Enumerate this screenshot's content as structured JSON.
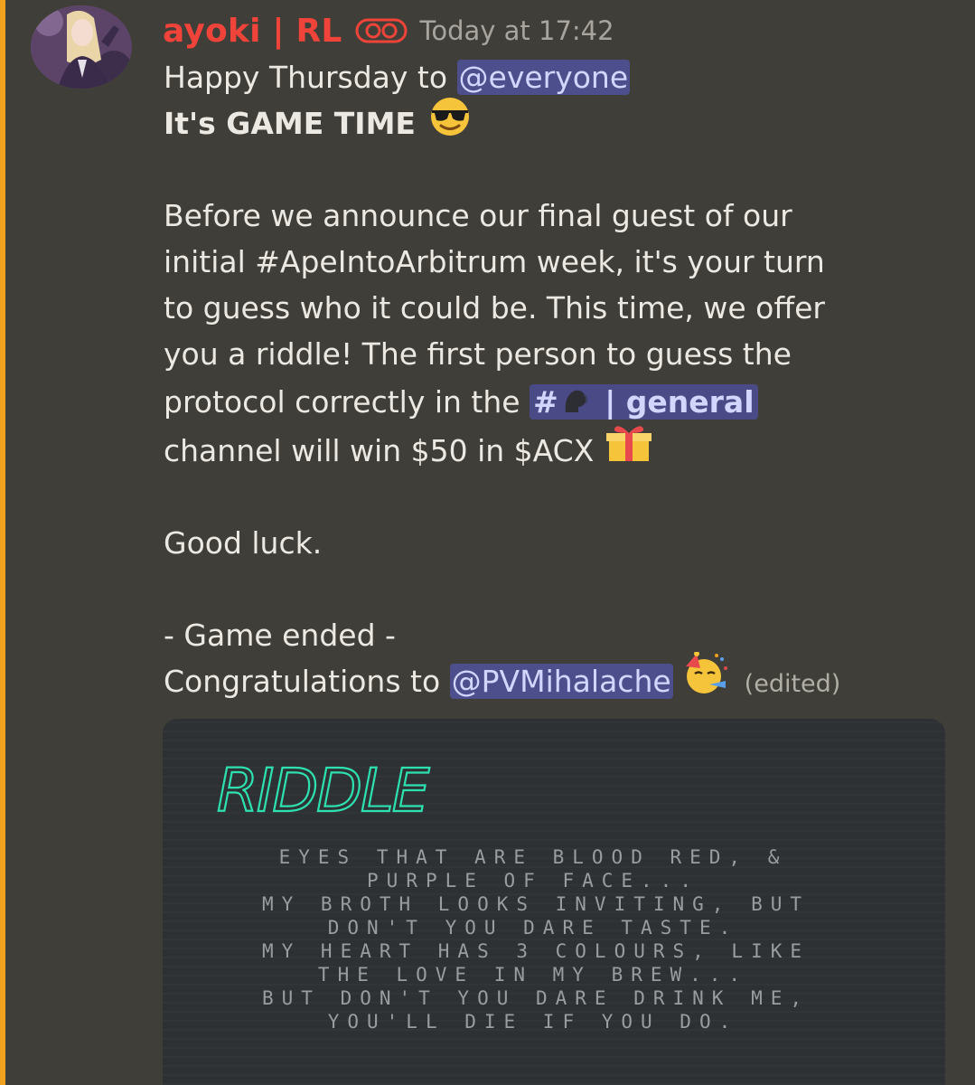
{
  "message": {
    "author": "ayoki | RL",
    "role_icon": "glasses-role-icon",
    "timestamp": "Today at 17:42",
    "greeting_text": "Happy Thursday to ",
    "greeting_mention": "@everyone",
    "game_time_text": "It's GAME TIME",
    "para_lines": [
      "Before we announce our final guest of our",
      "initial #ApeIntoArbitrum week, it's your turn",
      "to guess who it could be.  This time, we offer",
      "you a riddle! The first person to guess the"
    ],
    "protocol_text": "protocol correctly in the ",
    "channel_hash": "#",
    "channel_sep": "|",
    "channel_name": "general",
    "channel_line": "channel will win $50 in $ACX",
    "good_luck": "Good luck.",
    "game_ended": "- Game ended -",
    "congrats_text": "Congratulations to ",
    "congrats_mention": "@PVMihalache",
    "edited": "(edited)"
  },
  "embed": {
    "title": "RIDDLE",
    "riddle_lines": [
      "EYES THAT ARE BLOOD RED, &",
      "PURPLE OF FACE...",
      "MY BROTH LOOKS INVITING, BUT",
      "DON'T YOU DARE TASTE.",
      "MY HEART HAS 3 COLOURS, LIKE",
      "THE LOVE IN MY BREW...",
      "BUT DON'T YOU DARE DRINK ME,",
      "YOU'LL DIE IF YOU DO."
    ]
  },
  "colors": {
    "background": "#403e38",
    "accent_bar": "#f0a21f",
    "username": "#f0443a",
    "mention_bg": "#4d4f8c",
    "riddle_title": "#2de0b0"
  }
}
